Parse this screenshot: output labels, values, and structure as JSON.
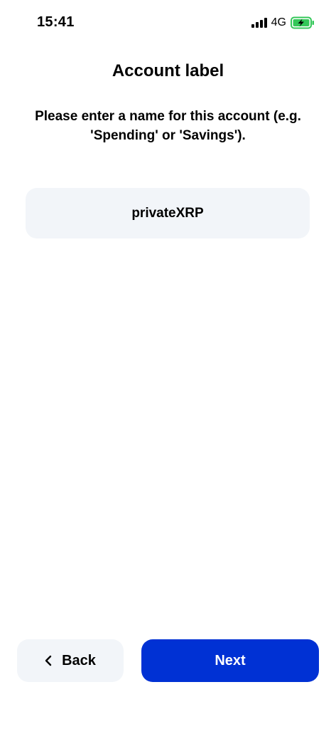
{
  "status_bar": {
    "time": "15:41",
    "network": "4G",
    "icons": [
      "signal-icon",
      "battery-charging-icon"
    ]
  },
  "screen": {
    "title": "Account label",
    "description": "Please enter a name for this account (e.g. 'Spending' or 'Savings')."
  },
  "label_input": {
    "value": "privateXRP"
  },
  "footer": {
    "back_label": "Back",
    "next_label": "Next"
  },
  "colors": {
    "accent": "#0031d4",
    "input_background": "#f2f5f9",
    "battery_fill": "#34c759"
  }
}
